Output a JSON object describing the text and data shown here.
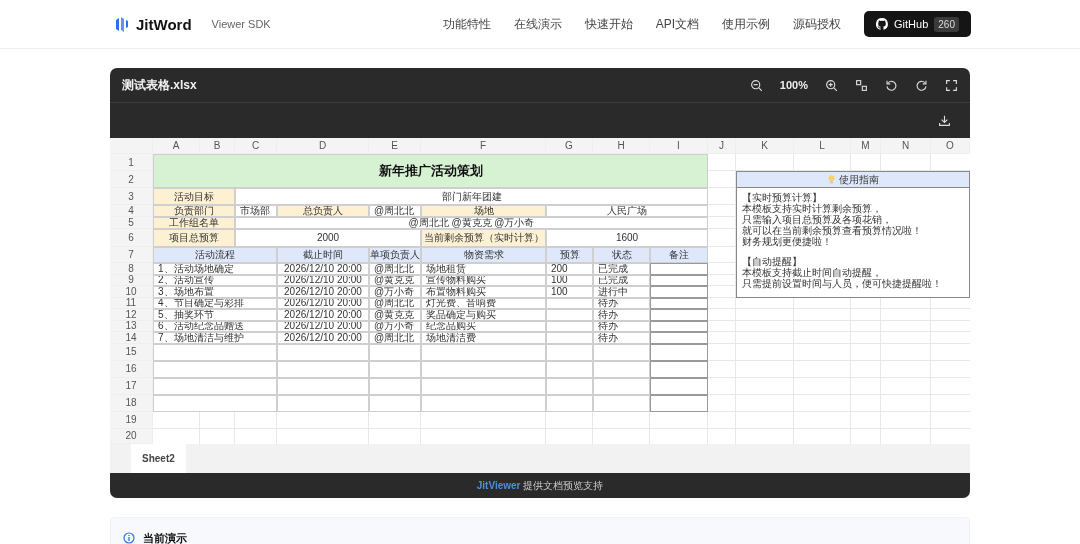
{
  "header": {
    "logo": "JitWord",
    "subtitle": "Viewer SDK",
    "nav": [
      "功能特性",
      "在线演示",
      "快速开始",
      "API文档",
      "使用示例",
      "源码授权"
    ],
    "github": {
      "label": "GitHub",
      "count": "260"
    }
  },
  "viewer": {
    "filename": "测试表格.xlsx",
    "zoom": "100%"
  },
  "sheet": {
    "columns": [
      "A",
      "B",
      "C",
      "D",
      "E",
      "F",
      "G",
      "H",
      "I",
      "J",
      "K",
      "L",
      "M",
      "N",
      "O"
    ],
    "rows": [
      "1",
      "2",
      "3",
      "4",
      "5",
      "6",
      "7",
      "8",
      "9",
      "10",
      "11",
      "12",
      "13",
      "14",
      "15",
      "16",
      "17",
      "18",
      "19",
      "20"
    ],
    "title": "新年推广活动策划",
    "goal": {
      "label": "活动目标",
      "value": "部门新年团建"
    },
    "dept": {
      "label": "负责部门",
      "value": "市场部"
    },
    "owner": {
      "label": "总负责人",
      "value": "@周北北"
    },
    "venue": {
      "label": "场地",
      "value": "人民广场"
    },
    "team": {
      "label": "工作组名单",
      "value": "@周北北 @黄克克 @万小奇"
    },
    "budget": {
      "label": "项目总预算",
      "value": "2000"
    },
    "remaining": {
      "label": "当前剩余预算（实时计算）",
      "value": "1600"
    },
    "table_columns": [
      "活动流程",
      "截止时间",
      "单项负责人",
      "物资需求",
      "预算",
      "状态",
      "备注"
    ],
    "table_rows": [
      {
        "step": "1、活动场地确定",
        "deadline": "2026/12/10 20:00",
        "owner": "@周北北",
        "supplies": "场地租赁",
        "budget": "200",
        "status": "已完成"
      },
      {
        "step": "2、活动宣传",
        "deadline": "2026/12/10 20:00",
        "owner": "@黄克克",
        "supplies": "宣传物料购买",
        "budget": "100",
        "status": "已完成"
      },
      {
        "step": "3、场地布置",
        "deadline": "2026/12/10 20:00",
        "owner": "@万小奇",
        "supplies": "布置物料购买",
        "budget": "100",
        "status": "进行中"
      },
      {
        "step": "4、节目确定与彩排",
        "deadline": "2026/12/10 20:00",
        "owner": "@周北北",
        "supplies": "灯光费、音响费",
        "status": "待办"
      },
      {
        "step": "5、抽奖环节",
        "deadline": "2026/12/10 20:00",
        "owner": "@黄克克",
        "supplies": "奖品确定与购买",
        "status": "待办"
      },
      {
        "step": "6、活动纪念品赠送",
        "deadline": "2026/12/10 20:00",
        "owner": "@万小奇",
        "supplies": "纪念品购买",
        "status": "待办"
      },
      {
        "step": "7、场地清洁与维护",
        "deadline": "2026/12/10 20:00",
        "owner": "@周北北",
        "supplies": "场地清洁费",
        "status": "待办"
      }
    ],
    "guide": {
      "title": "使用指南",
      "sections": [
        {
          "heading": "【实时预算计算】",
          "lines": [
            "本模板支持实时计算剩余预算，",
            "只需输入项目总预算及各项花销，",
            "就可以在当前剩余预算查看预算情况啦！",
            "财务规划更便捷啦！"
          ]
        },
        {
          "heading": "【自动提醒】",
          "lines": [
            "本模板支持截止时间自动提醒，",
            "只需提前设置时间与人员，便可快捷提醒啦！"
          ]
        }
      ]
    }
  },
  "sheet_tabs": [
    {
      "label": "Sheet2",
      "selected": true
    }
  ],
  "footer": {
    "brand": "JitViewer",
    "text": "提供文档预览支持"
  },
  "demo": {
    "title": "当前演示"
  }
}
